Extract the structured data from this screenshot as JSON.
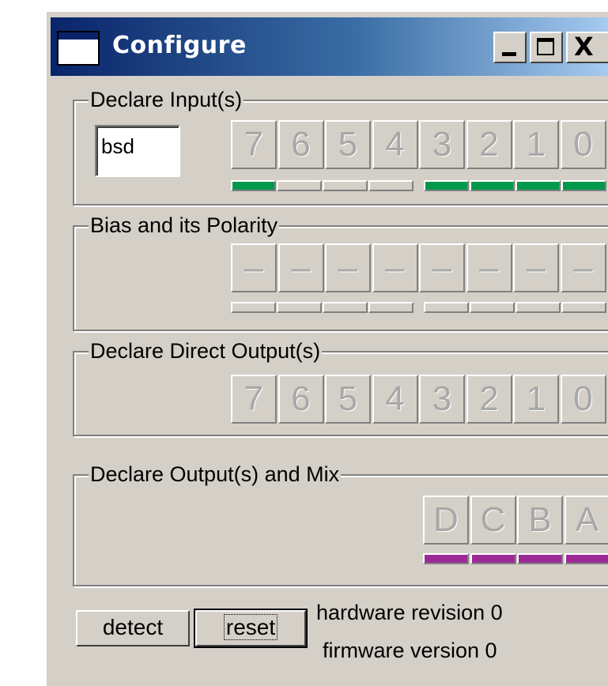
{
  "window": {
    "title": "Configure",
    "icon": "app-window-icon"
  },
  "caption_buttons": {
    "minimize": "minimize-icon",
    "maximize": "maximize-icon",
    "close_glyph": "X"
  },
  "inputs": {
    "label": "Declare Input(s)",
    "name_value": "bsd",
    "bits": [
      "7",
      "6",
      "5",
      "4",
      "3",
      "2",
      "1",
      "0"
    ],
    "indicators": [
      true,
      false,
      false,
      false,
      true,
      true,
      true,
      true
    ],
    "on_color": "#00994c"
  },
  "bias": {
    "label": "Bias and its Polarity",
    "bits": [
      "–",
      "–",
      "–",
      "–",
      "–",
      "–",
      "–",
      "–"
    ],
    "indicators": [
      false,
      false,
      false,
      false,
      false,
      false,
      false,
      false
    ]
  },
  "direct_outputs": {
    "label": "Declare Direct Output(s)",
    "bits": [
      "7",
      "6",
      "5",
      "4",
      "3",
      "2",
      "1",
      "0"
    ]
  },
  "outputs_mix": {
    "label": "Declare Output(s) and Mix",
    "channels": [
      "D",
      "C",
      "B",
      "A"
    ],
    "indicators": [
      true,
      true,
      true,
      true
    ],
    "on_color": "#9b2a96"
  },
  "footer": {
    "detect_label": "detect",
    "reset_label": "reset",
    "hardware_revision": "hardware revision 0",
    "firmware_version": "firmware version 0"
  }
}
